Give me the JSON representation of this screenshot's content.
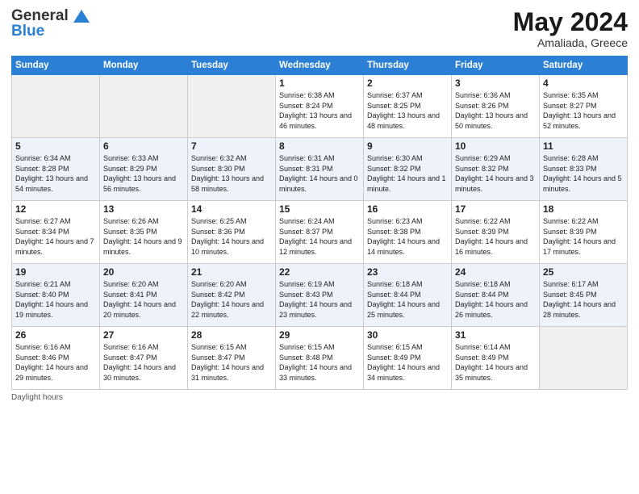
{
  "header": {
    "logo_general": "General",
    "logo_blue": "Blue",
    "month_title": "May 2024",
    "location": "Amaliada, Greece"
  },
  "days_of_week": [
    "Sunday",
    "Monday",
    "Tuesday",
    "Wednesday",
    "Thursday",
    "Friday",
    "Saturday"
  ],
  "footer_label": "Daylight hours",
  "rows": [
    {
      "cells": [
        {
          "day": "",
          "sunrise": "",
          "sunset": "",
          "daylight": "",
          "empty": true
        },
        {
          "day": "",
          "sunrise": "",
          "sunset": "",
          "daylight": "",
          "empty": true
        },
        {
          "day": "",
          "sunrise": "",
          "sunset": "",
          "daylight": "",
          "empty": true
        },
        {
          "day": "1",
          "sunrise": "Sunrise: 6:38 AM",
          "sunset": "Sunset: 8:24 PM",
          "daylight": "Daylight: 13 hours and 46 minutes."
        },
        {
          "day": "2",
          "sunrise": "Sunrise: 6:37 AM",
          "sunset": "Sunset: 8:25 PM",
          "daylight": "Daylight: 13 hours and 48 minutes."
        },
        {
          "day": "3",
          "sunrise": "Sunrise: 6:36 AM",
          "sunset": "Sunset: 8:26 PM",
          "daylight": "Daylight: 13 hours and 50 minutes."
        },
        {
          "day": "4",
          "sunrise": "Sunrise: 6:35 AM",
          "sunset": "Sunset: 8:27 PM",
          "daylight": "Daylight: 13 hours and 52 minutes."
        }
      ]
    },
    {
      "cells": [
        {
          "day": "5",
          "sunrise": "Sunrise: 6:34 AM",
          "sunset": "Sunset: 8:28 PM",
          "daylight": "Daylight: 13 hours and 54 minutes."
        },
        {
          "day": "6",
          "sunrise": "Sunrise: 6:33 AM",
          "sunset": "Sunset: 8:29 PM",
          "daylight": "Daylight: 13 hours and 56 minutes."
        },
        {
          "day": "7",
          "sunrise": "Sunrise: 6:32 AM",
          "sunset": "Sunset: 8:30 PM",
          "daylight": "Daylight: 13 hours and 58 minutes."
        },
        {
          "day": "8",
          "sunrise": "Sunrise: 6:31 AM",
          "sunset": "Sunset: 8:31 PM",
          "daylight": "Daylight: 14 hours and 0 minutes."
        },
        {
          "day": "9",
          "sunrise": "Sunrise: 6:30 AM",
          "sunset": "Sunset: 8:32 PM",
          "daylight": "Daylight: 14 hours and 1 minute."
        },
        {
          "day": "10",
          "sunrise": "Sunrise: 6:29 AM",
          "sunset": "Sunset: 8:32 PM",
          "daylight": "Daylight: 14 hours and 3 minutes."
        },
        {
          "day": "11",
          "sunrise": "Sunrise: 6:28 AM",
          "sunset": "Sunset: 8:33 PM",
          "daylight": "Daylight: 14 hours and 5 minutes."
        }
      ]
    },
    {
      "cells": [
        {
          "day": "12",
          "sunrise": "Sunrise: 6:27 AM",
          "sunset": "Sunset: 8:34 PM",
          "daylight": "Daylight: 14 hours and 7 minutes."
        },
        {
          "day": "13",
          "sunrise": "Sunrise: 6:26 AM",
          "sunset": "Sunset: 8:35 PM",
          "daylight": "Daylight: 14 hours and 9 minutes."
        },
        {
          "day": "14",
          "sunrise": "Sunrise: 6:25 AM",
          "sunset": "Sunset: 8:36 PM",
          "daylight": "Daylight: 14 hours and 10 minutes."
        },
        {
          "day": "15",
          "sunrise": "Sunrise: 6:24 AM",
          "sunset": "Sunset: 8:37 PM",
          "daylight": "Daylight: 14 hours and 12 minutes."
        },
        {
          "day": "16",
          "sunrise": "Sunrise: 6:23 AM",
          "sunset": "Sunset: 8:38 PM",
          "daylight": "Daylight: 14 hours and 14 minutes."
        },
        {
          "day": "17",
          "sunrise": "Sunrise: 6:22 AM",
          "sunset": "Sunset: 8:39 PM",
          "daylight": "Daylight: 14 hours and 16 minutes."
        },
        {
          "day": "18",
          "sunrise": "Sunrise: 6:22 AM",
          "sunset": "Sunset: 8:39 PM",
          "daylight": "Daylight: 14 hours and 17 minutes."
        }
      ]
    },
    {
      "cells": [
        {
          "day": "19",
          "sunrise": "Sunrise: 6:21 AM",
          "sunset": "Sunset: 8:40 PM",
          "daylight": "Daylight: 14 hours and 19 minutes."
        },
        {
          "day": "20",
          "sunrise": "Sunrise: 6:20 AM",
          "sunset": "Sunset: 8:41 PM",
          "daylight": "Daylight: 14 hours and 20 minutes."
        },
        {
          "day": "21",
          "sunrise": "Sunrise: 6:20 AM",
          "sunset": "Sunset: 8:42 PM",
          "daylight": "Daylight: 14 hours and 22 minutes."
        },
        {
          "day": "22",
          "sunrise": "Sunrise: 6:19 AM",
          "sunset": "Sunset: 8:43 PM",
          "daylight": "Daylight: 14 hours and 23 minutes."
        },
        {
          "day": "23",
          "sunrise": "Sunrise: 6:18 AM",
          "sunset": "Sunset: 8:44 PM",
          "daylight": "Daylight: 14 hours and 25 minutes."
        },
        {
          "day": "24",
          "sunrise": "Sunrise: 6:18 AM",
          "sunset": "Sunset: 8:44 PM",
          "daylight": "Daylight: 14 hours and 26 minutes."
        },
        {
          "day": "25",
          "sunrise": "Sunrise: 6:17 AM",
          "sunset": "Sunset: 8:45 PM",
          "daylight": "Daylight: 14 hours and 28 minutes."
        }
      ]
    },
    {
      "cells": [
        {
          "day": "26",
          "sunrise": "Sunrise: 6:16 AM",
          "sunset": "Sunset: 8:46 PM",
          "daylight": "Daylight: 14 hours and 29 minutes."
        },
        {
          "day": "27",
          "sunrise": "Sunrise: 6:16 AM",
          "sunset": "Sunset: 8:47 PM",
          "daylight": "Daylight: 14 hours and 30 minutes."
        },
        {
          "day": "28",
          "sunrise": "Sunrise: 6:15 AM",
          "sunset": "Sunset: 8:47 PM",
          "daylight": "Daylight: 14 hours and 31 minutes."
        },
        {
          "day": "29",
          "sunrise": "Sunrise: 6:15 AM",
          "sunset": "Sunset: 8:48 PM",
          "daylight": "Daylight: 14 hours and 33 minutes."
        },
        {
          "day": "30",
          "sunrise": "Sunrise: 6:15 AM",
          "sunset": "Sunset: 8:49 PM",
          "daylight": "Daylight: 14 hours and 34 minutes."
        },
        {
          "day": "31",
          "sunrise": "Sunrise: 6:14 AM",
          "sunset": "Sunset: 8:49 PM",
          "daylight": "Daylight: 14 hours and 35 minutes."
        },
        {
          "day": "",
          "sunrise": "",
          "sunset": "",
          "daylight": "",
          "empty": true
        }
      ]
    }
  ]
}
